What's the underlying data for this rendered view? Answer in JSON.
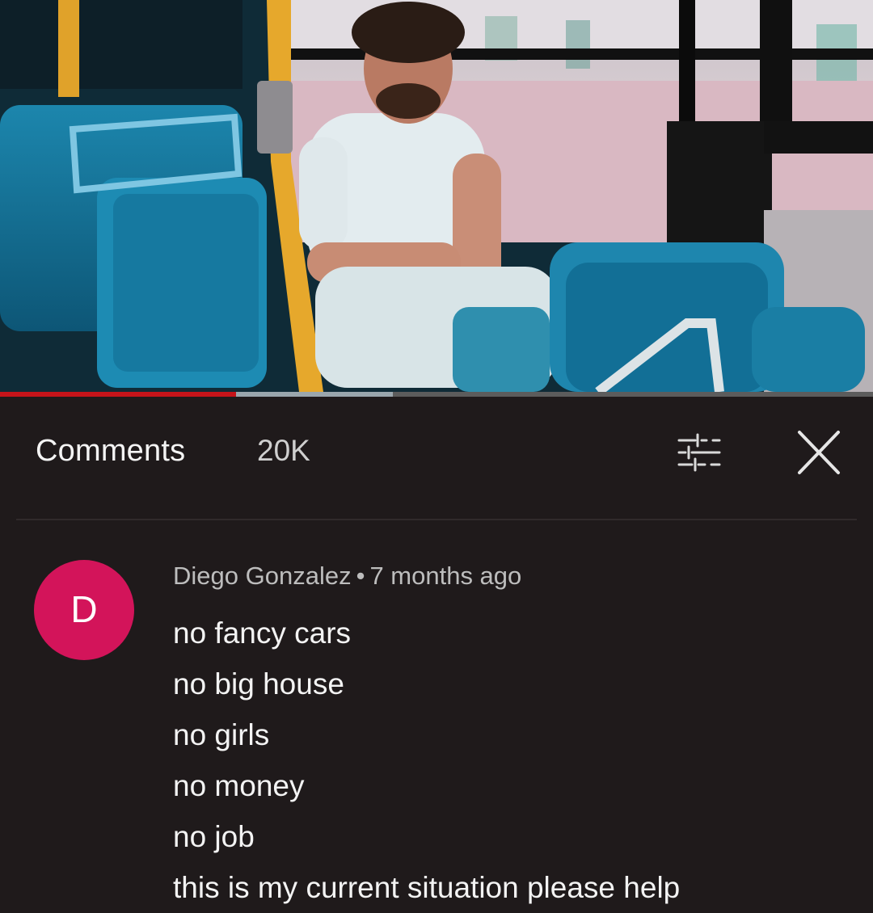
{
  "comments_panel": {
    "title": "Comments",
    "count": "20K",
    "filter_icon": "sliders-icon",
    "close_icon": "close-icon"
  },
  "video": {
    "progress_played_fraction": 0.27,
    "progress_buffered_fraction": 0.45,
    "colors": {
      "played": "#c5141a",
      "buffered": "#9aa6ad",
      "track": "#5c5c5c"
    }
  },
  "comment": {
    "avatar_letter": "D",
    "avatar_color": "#d3145a",
    "author": "Diego Gonzalez",
    "separator": "•",
    "time": "7 months ago",
    "lines": [
      "no fancy cars",
      "no big house",
      "no girls",
      "no money",
      "no job",
      "this is my current situation please help"
    ]
  }
}
